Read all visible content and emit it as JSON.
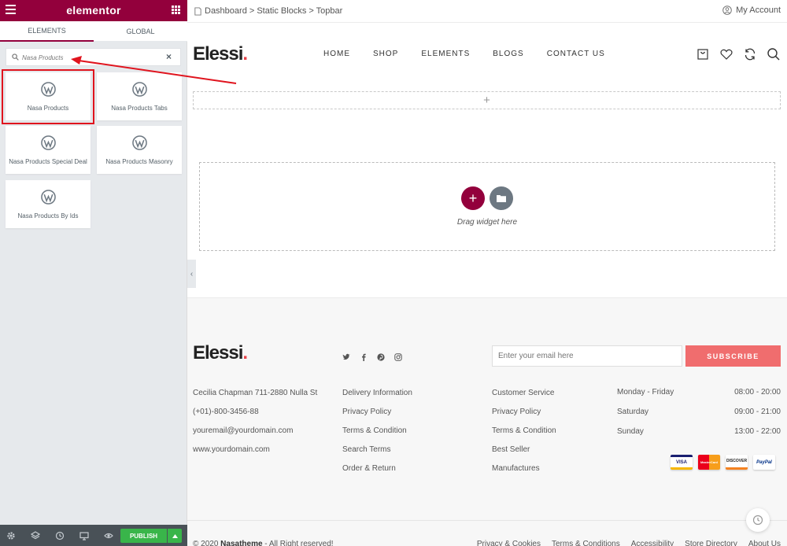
{
  "editor": {
    "brand": "elementor",
    "tabs": [
      {
        "label": "ELEMENTS"
      },
      {
        "label": "GLOBAL"
      }
    ],
    "search": {
      "value": "Nasa Products",
      "clear_label": "×"
    },
    "widgets": [
      {
        "label": "Nasa Products"
      },
      {
        "label": "Nasa Products Tabs"
      },
      {
        "label": "Nasa Products Special Deal"
      },
      {
        "label": "Nasa Products Masonry"
      },
      {
        "label": "Nasa Products By Ids"
      }
    ],
    "publish_label": "PUBLISH",
    "accent_color": "#93003c",
    "publish_color": "#39b54a",
    "highlight_color": "#e0141e"
  },
  "topbar": {
    "breadcrumb": "Dashboard > Static Blocks > Topbar",
    "account_label": "My Account"
  },
  "site": {
    "logo_text": "Elessi",
    "logo_dot": ".",
    "nav": [
      {
        "label": "HOME"
      },
      {
        "label": "SHOP"
      },
      {
        "label": "ELEMENTS"
      },
      {
        "label": "BLOGS"
      },
      {
        "label": "CONTACT US"
      }
    ],
    "add_section_label": "+",
    "drop_text": "Drag widget here",
    "drop_plus": "+"
  },
  "footer": {
    "email_placeholder": "Enter your email here",
    "subscribe_label": "SUBSCRIBE",
    "contact": [
      "Cecilia Chapman 711-2880 Nulla St",
      "(+01)-800-3456-88",
      "youremail@yourdomain.com",
      "www.yourdomain.com"
    ],
    "links1": [
      "Delivery Information",
      "Privacy Policy",
      "Terms & Condition",
      "Search Terms",
      "Order & Return"
    ],
    "links2": [
      "Customer Service",
      "Privacy Policy",
      "Terms & Condition",
      "Best Seller",
      "Manufactures"
    ],
    "hours": [
      {
        "day": "Monday - Friday",
        "time": "08:00 - 20:00"
      },
      {
        "day": "Saturday",
        "time": "09:00 - 21:00"
      },
      {
        "day": "Sunday",
        "time": "13:00 - 22:00"
      }
    ],
    "payments": [
      "VISA",
      "MasterCard",
      "DISCOVER",
      "PayPal"
    ],
    "copyright_prefix": "© 2020 ",
    "copyright_brand": "Nasatheme",
    "copyright_suffix": " - All Right reserved!",
    "bottom_links": [
      "Privacy & Cookies",
      "Terms & Conditions",
      "Accessibility",
      "Store Directory",
      "About Us"
    ]
  }
}
